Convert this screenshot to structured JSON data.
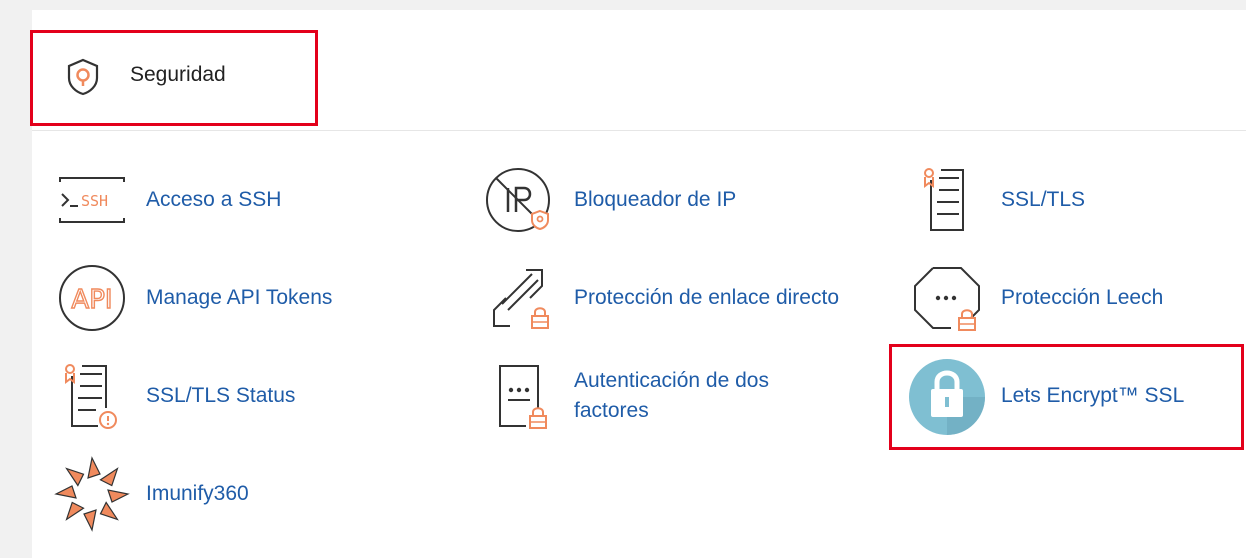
{
  "section": {
    "title": "Seguridad",
    "icon": "shield-icon"
  },
  "colors": {
    "link": "#1f5ca8",
    "accent": "#f08a5d",
    "highlight": "#e3001b",
    "lets_circle": "#7fbfd2"
  },
  "items": [
    {
      "label": "Acceso a SSH",
      "icon": "ssh-terminal-icon"
    },
    {
      "label": "Bloqueador de IP",
      "icon": "ip-blocker-icon"
    },
    {
      "label": "SSL/TLS",
      "icon": "certificate-icon"
    },
    {
      "label": "Manage API Tokens",
      "icon": "api-icon"
    },
    {
      "label": "Protección de enlace directo",
      "icon": "link-lock-icon"
    },
    {
      "label": "Protección Leech",
      "icon": "leech-lock-icon"
    },
    {
      "label": "SSL/TLS Status",
      "icon": "certificate-status-icon"
    },
    {
      "label": "Autenticación de dos factores",
      "icon": "two-factor-icon"
    },
    {
      "label": "Lets Encrypt™ SSL",
      "icon": "padlock-icon"
    },
    {
      "label": "Imunify360",
      "icon": "imunify-icon"
    }
  ]
}
